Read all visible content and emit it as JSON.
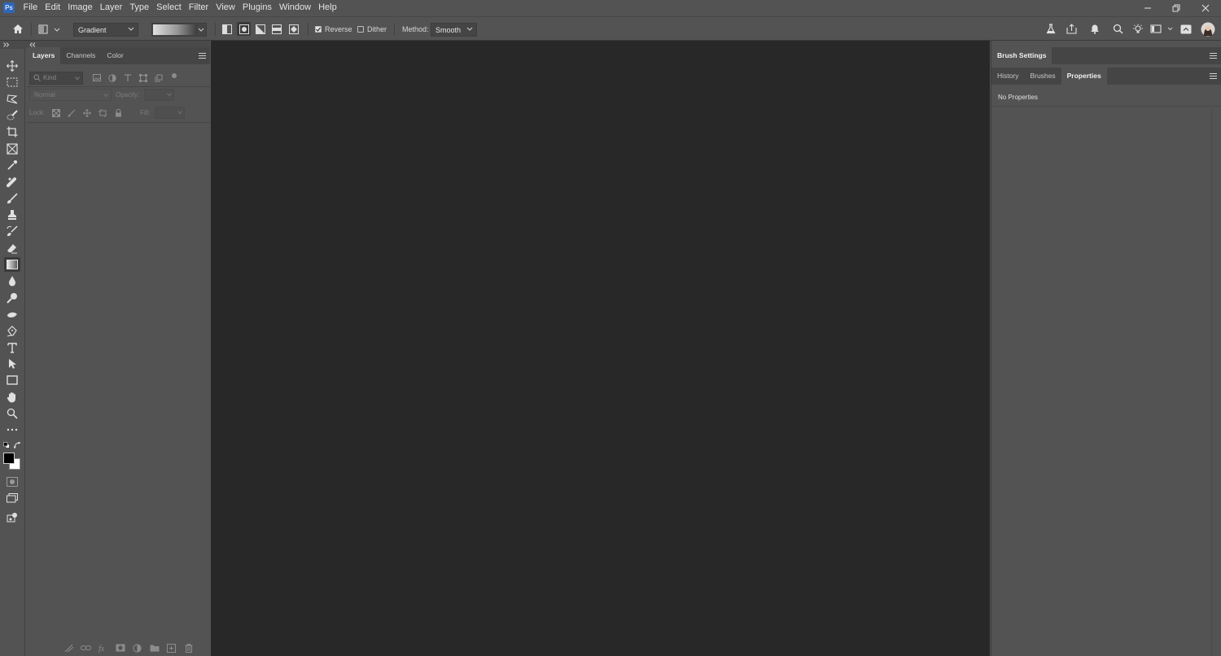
{
  "menu": {
    "items": [
      "File",
      "Edit",
      "Image",
      "Layer",
      "Type",
      "Select",
      "Filter",
      "View",
      "Plugins",
      "Window",
      "Help"
    ],
    "app_logo_text": "Ps"
  },
  "options": {
    "preset_select": "Gradient",
    "reverse_label": "Reverse",
    "reverse_checked": true,
    "dither_label": "Dither",
    "dither_checked": false,
    "method_label": "Method:",
    "method_value": "Smooth"
  },
  "layers_panel": {
    "tabs": [
      "Layers",
      "Channels",
      "Color"
    ],
    "active_tab": "Layers",
    "kind_placeholder": "Kind",
    "blend_mode": "Normal",
    "opacity_label": "Opacity:",
    "lock_label": "Lock:",
    "fill_label": "Fill:"
  },
  "right_dock": {
    "top_tabs": [
      "Brush Settings"
    ],
    "tabs": [
      "History",
      "Brushes",
      "Properties"
    ],
    "active_tab": "Properties",
    "properties_text": "No Properties"
  },
  "tools": [
    "move",
    "marquee",
    "lasso",
    "quick-select",
    "crop",
    "frame",
    "eyedropper",
    "spot-healing",
    "brush",
    "clone-stamp",
    "history-brush",
    "eraser",
    "gradient",
    "blur",
    "dodge",
    "smudge",
    "pen",
    "type",
    "path-select",
    "rectangle",
    "hand",
    "zoom",
    "more-tools"
  ],
  "active_tool": "gradient",
  "colors": {
    "foreground": "#000000",
    "background": "#ffffff",
    "canvas": "#282828",
    "panel": "#535353"
  }
}
